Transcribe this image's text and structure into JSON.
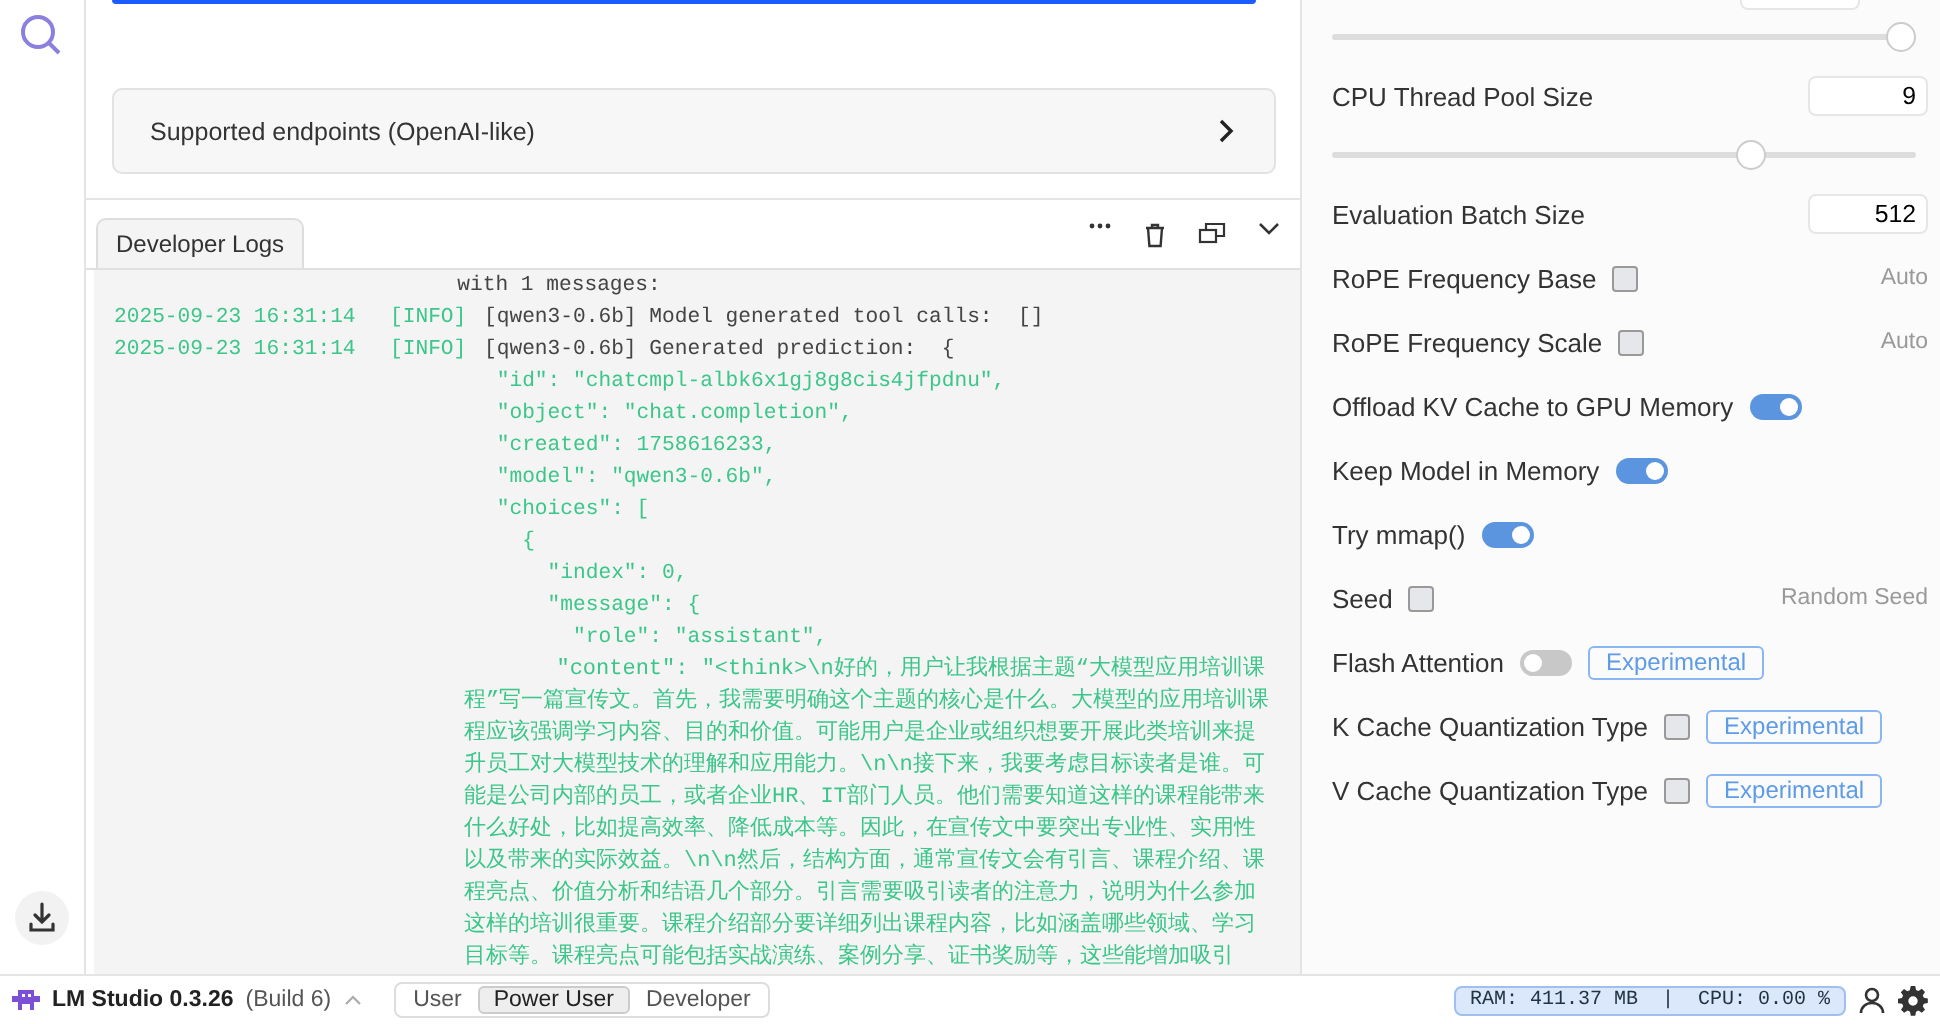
{
  "endpoints_card": {
    "label": "Supported endpoints (OpenAI-like)"
  },
  "logs": {
    "tab": {
      "label": "Developer Logs"
    },
    "lines": [
      {
        "kind": "plain",
        "text": "                           with 1 messages:"
      },
      {
        "kind": "entry",
        "timestamp": "2025-09-23 16:31:14",
        "level": "[INFO]",
        "text": "[qwen3-0.6b] Model generated tool calls:  []"
      },
      {
        "kind": "entry",
        "timestamp": "2025-09-23 16:31:14",
        "level": "[INFO]",
        "text": "[qwen3-0.6b] Generated prediction:  {"
      },
      {
        "kind": "json",
        "text": " \"id\": \"chatcmpl-albk6x1gj8g8cis4jfpdnu\","
      },
      {
        "kind": "json",
        "text": " \"object\": \"chat.completion\","
      },
      {
        "kind": "json",
        "text": " \"created\": 1758616233,"
      },
      {
        "kind": "json",
        "text": " \"model\": \"qwen3-0.6b\","
      },
      {
        "kind": "json",
        "text": " \"choices\": ["
      },
      {
        "kind": "json",
        "text": "   {"
      },
      {
        "kind": "json",
        "text": "     \"index\": 0,"
      },
      {
        "kind": "json",
        "text": "     \"message\": {"
      },
      {
        "kind": "json",
        "text": "       \"role\": \"assistant\","
      },
      {
        "kind": "json",
        "text": "       \"content\": \"<think>\\n好的，用户让我根据主题“大模型应用培训课程”写一篇宣传文。首先，我需要明确这个主题的核心是什么。大模型的应用培训课程应该强调学习内容、目的和价值。可能用户是企业或组织想要开展此类培训来提升员工对大模型技术的理解和应用能力。\\n\\n接下来，我要考虑目标读者是谁。可能是公司内部的员工，或者企业HR、IT部门人员。他们需要知道这样的课程能带来什么好处，比如提高效率、降低成本等。因此，在宣传文中要突出专业性、实用性以及带来的实际效益。\\n\\n然后，结构方面，通常宣传文会有引言、课程介绍、课程亮点、价值分析和结语几个部分。引言需要吸引读者的注意力，说明为什么参加这样的培训很重要。课程介绍部分要详细列出课程内容，比如涵盖哪些领域、学习目标等。课程亮点可能包括实战演练、案例分享、证书奖励等，这些能增加吸引"
      }
    ]
  },
  "settings": [
    {
      "kind": "slider",
      "level": 1.0
    },
    {
      "kind": "number",
      "label": "CPU Thread Pool Size",
      "value": "9"
    },
    {
      "kind": "slider",
      "level": 0.73
    },
    {
      "kind": "number",
      "label": "Evaluation Batch Size",
      "value": "512"
    },
    {
      "kind": "checkbox",
      "label": "RoPE Frequency Base",
      "checked": false,
      "hint": "Auto"
    },
    {
      "kind": "checkbox",
      "label": "RoPE Frequency Scale",
      "checked": false,
      "hint": "Auto"
    },
    {
      "kind": "toggle",
      "label": "Offload KV Cache to GPU Memory",
      "on": true
    },
    {
      "kind": "toggle",
      "label": "Keep Model in Memory",
      "on": true
    },
    {
      "kind": "toggle",
      "label": "Try mmap()",
      "on": true
    },
    {
      "kind": "checkbox",
      "label": "Seed",
      "checked": false,
      "hint": "Random Seed"
    },
    {
      "kind": "toggle",
      "label": "Flash Attention",
      "on": false,
      "badge": "Experimental"
    },
    {
      "kind": "checkbox",
      "label": "K Cache Quantization Type",
      "checked": false,
      "badge": "Experimental"
    },
    {
      "kind": "checkbox",
      "label": "V Cache Quantization Type",
      "checked": false,
      "badge": "Experimental"
    }
  ],
  "status_bar": {
    "app_name": "LM Studio 0.3.26",
    "build": "(Build 6)",
    "modes": [
      {
        "label": "User",
        "selected": false
      },
      {
        "label": "Power User",
        "selected": true
      },
      {
        "label": "Developer",
        "selected": false
      }
    ],
    "resources": "RAM: 411.37 MB  |  CPU: 0.00 %"
  }
}
